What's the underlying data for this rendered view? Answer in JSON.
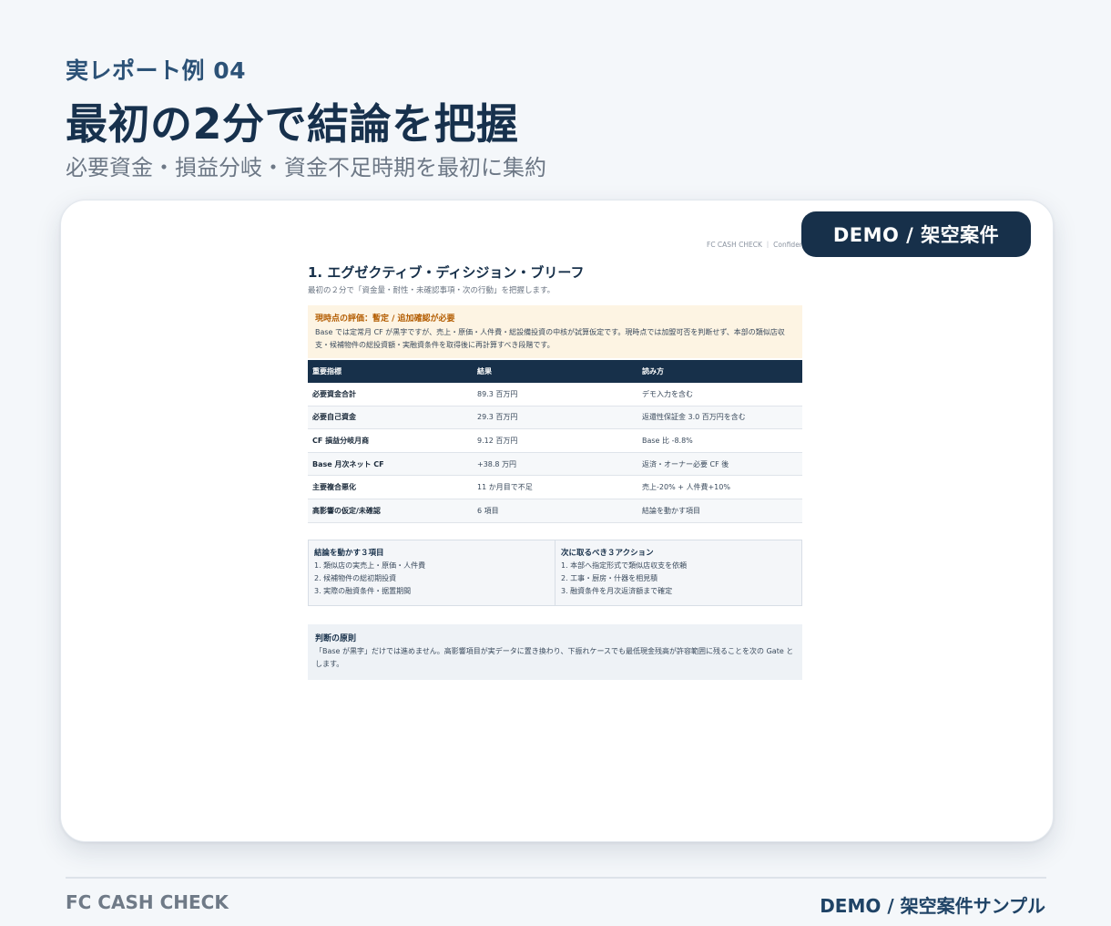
{
  "header": {
    "kicker": "実レポート例 04",
    "title": "最初の2分で結論を把握",
    "subtitle": "必要資金・損益分岐・資金不足時期を最初に集約"
  },
  "badge": "DEMO / 架空案件",
  "report": {
    "confidential": "FC CASH CHECK ｜ Confidential",
    "title": "1. エグゼクティブ・ディシジョン・ブリーフ",
    "subtitle": "最初の２分で「資金量・耐性・未確認事項・次の行動」を把握します。",
    "alert": {
      "title": "現時点の評価：暫定 / 追加確認が必要",
      "text": "Base では定常月 CF が黒字ですが、売上・原価・人件費・総設備投資の中核が試算仮定です。現時点では加盟可否を判断せず、本部の類似店収支・候補物件の総投資額・実融資条件を取得後に再計算すべき段階です。"
    },
    "table": {
      "headers": [
        "重要指標",
        "結果",
        "読み方"
      ],
      "rows": [
        [
          "必要資金合計",
          "89.3 百万円",
          "デモ入力を含む"
        ],
        [
          "必要自己資金",
          "29.3 百万円",
          "返還性保証金 3.0 百万円を含む"
        ],
        [
          "CF 損益分岐月商",
          "9.12 百万円",
          "Base 比 -8.8%"
        ],
        [
          "Base 月次ネット CF",
          "+38.8 万円",
          "返済・オーナー必要 CF 後"
        ],
        [
          "主要複合悪化",
          "11 か月目で不足",
          "売上-20% + 人件費+10%"
        ],
        [
          "高影響の仮定/未確認",
          "6 項目",
          "結論を動かす項目"
        ]
      ]
    },
    "boxes": [
      {
        "title": "結論を動かす３項目",
        "items": [
          "1. 類似店の実売上・原価・人件費",
          "2. 候補物件の総初期投資",
          "3. 実際の融資条件・据置期間"
        ]
      },
      {
        "title": "次に取るべき３アクション",
        "items": [
          "1. 本部へ指定形式で類似店収支を依頼",
          "2. 工事・厨房・什器を相見積",
          "3. 融資条件を月次返済額まで確定"
        ]
      }
    ],
    "principle": {
      "title": "判断の原則",
      "text": "「Base が黒字」だけでは進めません。高影響項目が実データに置き換わり、下振れケースでも最低現金残高が許容範囲に残ることを次の Gate とします。"
    }
  },
  "footer": {
    "left": "FC CASH CHECK",
    "right": "DEMO / 架空案件サンプル"
  }
}
